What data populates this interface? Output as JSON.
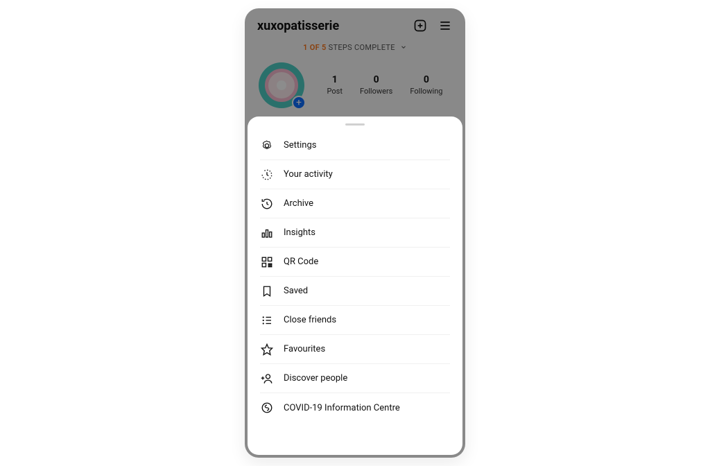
{
  "header": {
    "username": "xuxopatisserie"
  },
  "steps": {
    "highlight": "1 OF 5",
    "rest": "STEPS COMPLETE"
  },
  "stats": {
    "posts": {
      "count": "1",
      "label": "Post"
    },
    "followers": {
      "count": "0",
      "label": "Followers"
    },
    "following": {
      "count": "0",
      "label": "Following"
    }
  },
  "menu": [
    {
      "label": "Settings",
      "icon": "gear-icon"
    },
    {
      "label": "Your activity",
      "icon": "activity-icon"
    },
    {
      "label": "Archive",
      "icon": "archive-icon"
    },
    {
      "label": "Insights",
      "icon": "insights-icon"
    },
    {
      "label": "QR Code",
      "icon": "qrcode-icon"
    },
    {
      "label": "Saved",
      "icon": "bookmark-icon"
    },
    {
      "label": "Close friends",
      "icon": "close-friends-icon"
    },
    {
      "label": "Favourites",
      "icon": "star-icon"
    },
    {
      "label": "Discover people",
      "icon": "discover-people-icon"
    },
    {
      "label": "COVID-19 Information Centre",
      "icon": "covid-info-icon"
    }
  ]
}
